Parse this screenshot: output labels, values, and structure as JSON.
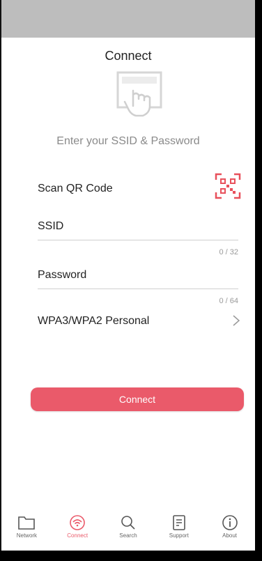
{
  "header": {
    "title": "Connect"
  },
  "hero": {
    "icon": "tap-hand-icon",
    "subtitle": "Enter your SSID & Password"
  },
  "qr": {
    "label": "Scan QR Code",
    "icon": "qr-scan-icon",
    "accent": "#e8505b"
  },
  "ssid": {
    "label": "SSID",
    "value": "",
    "counter": "0 / 32"
  },
  "password": {
    "label": "Password",
    "value": "",
    "counter": "0 / 64"
  },
  "security": {
    "label": "WPA3/WPA2 Personal",
    "icon": "chevron-right-icon"
  },
  "actions": {
    "connect_label": "Connect",
    "color": "#ea5a6a"
  },
  "tabs": [
    {
      "label": "Network",
      "icon": "folder-icon",
      "active": false
    },
    {
      "label": "Connect",
      "icon": "wifi-connect-icon",
      "active": true
    },
    {
      "label": "Search",
      "icon": "search-icon",
      "active": false
    },
    {
      "label": "Support",
      "icon": "document-icon",
      "active": false
    },
    {
      "label": "About",
      "icon": "info-icon",
      "active": false
    }
  ]
}
